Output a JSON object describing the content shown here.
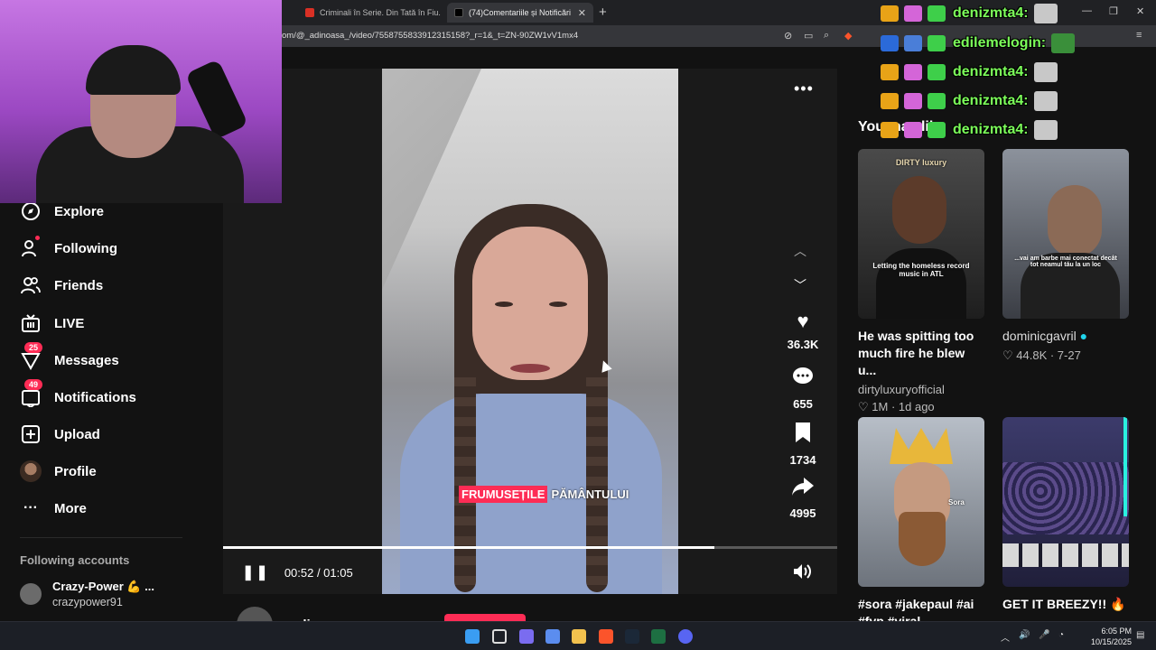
{
  "browser": {
    "tabs": [
      {
        "label": "Criminali în Serie. Din Tată în Fiu. De",
        "favicon_color": "#d93025"
      },
      {
        "label": "(74)Comentariile și Notificări",
        "favicon_color": "#000000"
      }
    ],
    "new_tab": "+",
    "url": "om/@_adinoasa_/video/7558755833912315158?_r=1&_t=ZN-90ZW1vV1mx4"
  },
  "sidebar": {
    "items": [
      {
        "label": "Explore",
        "icon": "compass-icon"
      },
      {
        "label": "Following",
        "icon": "following-icon"
      },
      {
        "label": "Friends",
        "icon": "friends-icon"
      },
      {
        "label": "LIVE",
        "icon": "live-icon"
      },
      {
        "label": "Messages",
        "icon": "messages-icon",
        "badge": "25"
      },
      {
        "label": "Notifications",
        "icon": "notifications-icon",
        "badge": "49"
      },
      {
        "label": "Upload",
        "icon": "upload-icon"
      },
      {
        "label": "Profile",
        "icon": "profile-avatar"
      },
      {
        "label": "More",
        "icon": "more-icon"
      }
    ],
    "following_header": "Following accounts",
    "following": [
      {
        "name": "Crazy-Power 💪 ...",
        "handle": "crazypower91"
      }
    ]
  },
  "video": {
    "caption_highlight": "FRUMUSEȚILE",
    "caption_rest": "PĂMÂNTULUI",
    "likes": "36.3K",
    "comments": "655",
    "saves": "1734",
    "shares": "4995",
    "time": "00:52 / 01:05",
    "progress": 0.8,
    "author": "adinoasa"
  },
  "recommendations": {
    "title": "You may like",
    "items": [
      {
        "title": "He was spitting too much fire he blew u...",
        "author": "dirtyluxuryofficial",
        "stats": "1M · 1d ago",
        "overlay": "Letting the homeless record music in ATL",
        "brand": "DIRTY luxury"
      },
      {
        "title": "",
        "author": "dominicgavril",
        "verified": true,
        "stats": "44.8K · 7-27",
        "overlay": "...vai am barbe mai conectat decât tot neamul tău la un loc"
      },
      {
        "title": "#sora #jakepaul #ai #fyp #viral",
        "author": "",
        "stats": "",
        "overlay": "Sora"
      },
      {
        "title": "GET IT BREEZY!! 🔥",
        "author": "",
        "stats": "",
        "overlay": ""
      }
    ]
  },
  "chat": [
    {
      "name": "denizmta4:"
    },
    {
      "name": "edilemelogin:"
    },
    {
      "name": "denizmta4:"
    },
    {
      "name": "denizmta4:"
    },
    {
      "name": "denizmta4:"
    }
  ],
  "taskbar": {
    "time": "6:05 PM",
    "date": "10/15/2025"
  },
  "colors": {
    "accent": "#fe2c55",
    "chat_name": "#7cff5a",
    "page_bg": "#121212"
  }
}
